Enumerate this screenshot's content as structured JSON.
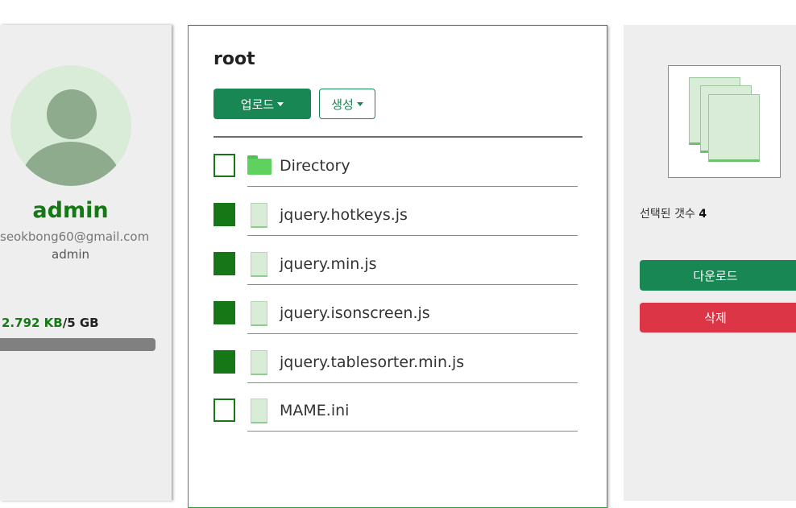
{
  "user": {
    "name": "admin",
    "email": "seokbong60@gmail.com",
    "role": "admin",
    "storage_used": "2.792 KB",
    "storage_total": "/5 GB"
  },
  "folder": {
    "title": "root",
    "upload_label": "업로드",
    "create_label": "생성"
  },
  "files": [
    {
      "name": "Directory",
      "type": "folder",
      "checked": false
    },
    {
      "name": "jquery.hotkeys.js",
      "type": "file",
      "checked": true
    },
    {
      "name": "jquery.min.js",
      "type": "file",
      "checked": true
    },
    {
      "name": "jquery.isonscreen.js",
      "type": "file",
      "checked": true
    },
    {
      "name": "jquery.tablesorter.min.js",
      "type": "file",
      "checked": true
    },
    {
      "name": "MAME.ini",
      "type": "file",
      "checked": false
    }
  ],
  "selection": {
    "label": "선택된 갯수",
    "count": "4",
    "download_label": "다운로드",
    "delete_label": "삭제"
  },
  "colors": {
    "accent": "#198754",
    "brand_text": "#157715",
    "danger": "#dc3545"
  },
  "icons": {
    "avatar": "user-avatar-icon",
    "folder": "folder-icon",
    "file": "file-icon",
    "preview": "multi-file-icon"
  }
}
